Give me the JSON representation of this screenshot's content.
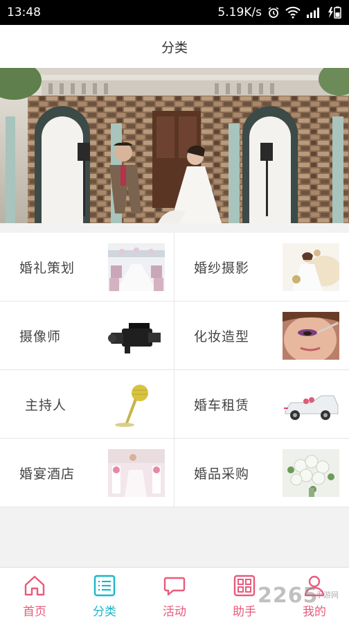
{
  "status_bar": {
    "time": "13:48",
    "net_speed": "5.19K/s"
  },
  "title": "分类",
  "banner": {
    "dot_colors": [
      "#f4a93a",
      "#25c5d6"
    ]
  },
  "categories": [
    {
      "label": "婚礼策划",
      "thumb": "wedding-hall"
    },
    {
      "label": "婚纱摄影",
      "thumb": "bride-photo"
    },
    {
      "label": "摄像师",
      "thumb": "video-camera"
    },
    {
      "label": "化妆造型",
      "thumb": "makeup"
    },
    {
      "label": "主持人",
      "thumb": "microphone"
    },
    {
      "label": "婚车租赁",
      "thumb": "wedding-car"
    },
    {
      "label": "婚宴酒店",
      "thumb": "banquet-hall"
    },
    {
      "label": "婚品采购",
      "thumb": "bouquet"
    }
  ],
  "tabs": [
    {
      "label": "首页",
      "icon": "home-icon"
    },
    {
      "label": "分类",
      "icon": "list-icon",
      "active": true
    },
    {
      "label": "活动",
      "icon": "chat-bubble-icon"
    },
    {
      "label": "助手",
      "icon": "grid-icon"
    },
    {
      "label": "我的",
      "icon": "user-icon"
    }
  ],
  "watermark": {
    "text": "2265",
    "small": "手游网"
  },
  "colors": {
    "accent_pink": "#e85a7a",
    "accent_teal": "#17b8c8"
  }
}
